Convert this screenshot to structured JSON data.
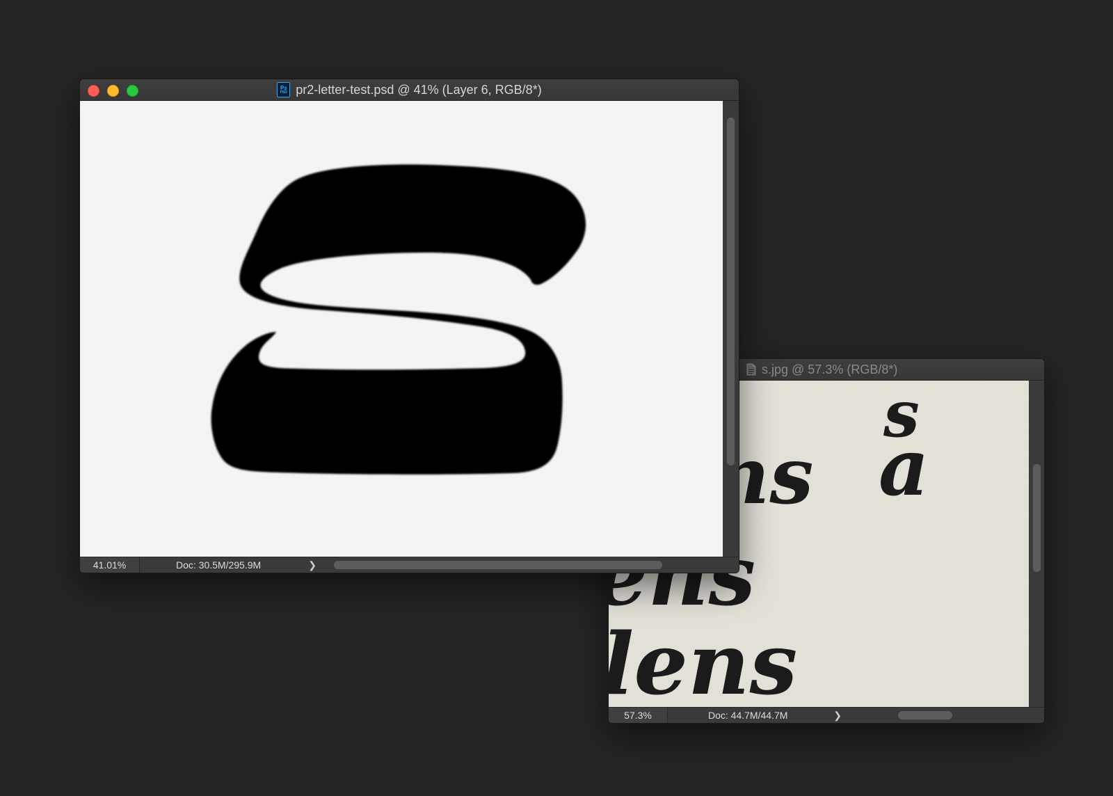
{
  "main_window": {
    "title": "pr2-letter-test.psd @ 41% (Layer 6, RGB/8*)",
    "file_icon": "photoshop-psd-icon",
    "file_icon_label": "Ps",
    "file_icon_sub": "PSD",
    "zoom": "41.01%",
    "doc_info": "Doc: 30.5M/295.9M",
    "arrow": "❯"
  },
  "secondary_window": {
    "title": "s.jpg @ 57.3% (RGB/8*)",
    "file_icon": "jpeg-file-icon",
    "zoom": "57.3%",
    "doc_info": "Doc: 44.7M/44.7M",
    "arrow": "❯",
    "scan_text": {
      "top_letter": "s",
      "line1_left": "ns",
      "line1_right": "a",
      "line2": "ens",
      "line3": "lens"
    }
  },
  "colors": {
    "desktop": "#252525",
    "canvas_bg": "#f5f4f2",
    "paper": "#e2e0d7",
    "ink": "#000000",
    "close": "#ff5f57",
    "minimize": "#febc2e",
    "maximize": "#28c840"
  }
}
